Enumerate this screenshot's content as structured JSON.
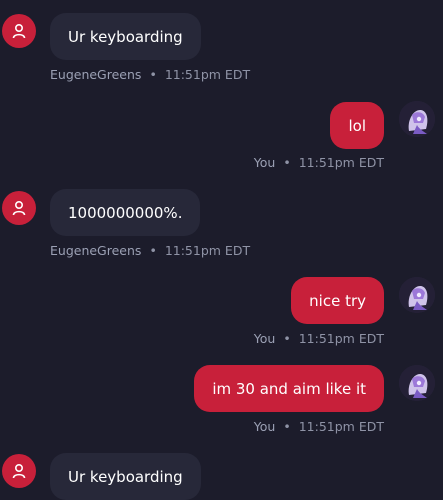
{
  "messages": [
    {
      "side": "in",
      "text": "Ur keyboarding",
      "author": "EugeneGreens",
      "time": "11:51pm EDT"
    },
    {
      "side": "out",
      "text": "lol",
      "author": "You",
      "time": "11:51pm EDT"
    },
    {
      "side": "in",
      "text": "1000000000%.",
      "author": "EugeneGreens",
      "time": "11:51pm EDT"
    },
    {
      "side": "out",
      "text": "nice try",
      "author": "You",
      "time": "11:51pm EDT"
    },
    {
      "side": "out",
      "text": "im 30 and aim like it",
      "author": "You",
      "time": "11:51pm EDT"
    },
    {
      "side": "in",
      "text": "Ur keyboarding",
      "author": "",
      "time": ""
    }
  ],
  "separator": "•",
  "colors": {
    "background": "#1c1c2b",
    "incoming_bubble": "#272839",
    "outgoing_bubble": "#c8203a",
    "meta_text": "#8f93a6"
  },
  "icons": {
    "incoming_avatar": "user-icon",
    "outgoing_avatar": "anime-avatar-image"
  }
}
